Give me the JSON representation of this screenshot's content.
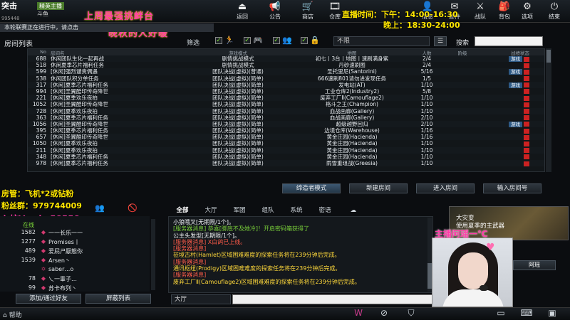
{
  "header": {
    "logo": "突击",
    "channel_badge": "精英主播",
    "channel_name": "斗鱼",
    "channel_code": "995448",
    "buttons": [
      {
        "icon": "back-icon",
        "glyph": "⏏",
        "label": "返回"
      },
      {
        "icon": "announce-icon",
        "glyph": "📢",
        "label": "公告"
      },
      {
        "icon": "shop-icon",
        "glyph": "🛒",
        "label": "商店"
      },
      {
        "icon": "warehouse-icon",
        "glyph": "🎞",
        "label": "仓库"
      },
      {
        "icon": "info-icon",
        "glyph": "👤",
        "label": "信息"
      },
      {
        "icon": "mail-icon",
        "glyph": "✉",
        "label": "邮件"
      },
      {
        "icon": "battle-icon",
        "glyph": "⚔",
        "label": "战队"
      },
      {
        "icon": "backpack-icon",
        "glyph": "🎒",
        "label": "背包"
      },
      {
        "icon": "gear-icon",
        "glyph": "⚙",
        "label": "选项"
      },
      {
        "icon": "power-icon",
        "glyph": "⏻",
        "label": "结束"
      }
    ],
    "stream_time_1": "直播时间：下午：14:00-16:30",
    "stream_time_2": "晚上：18:30-24:00"
  },
  "overlay": {
    "title_1": "上周最强挑衅台",
    "title_2": "晚秋的人好暖",
    "room_admin": "房管：飞机*2或钻粉",
    "fans_group": "粉丝群：979744009",
    "pit_id": "入坑V：sky58558",
    "host_name": "主播阿瑶一℃"
  },
  "status_text": "本轮联赛正在进行中，请点击",
  "room_list": {
    "title": "房间列表",
    "filter_label": "筛选",
    "availability": "不限",
    "search_label": "搜索",
    "search_placeholder": "",
    "columns": [
      "No",
      "房间名",
      "游戏模式",
      "地图",
      "人数",
      "阶级",
      "战绩状态"
    ],
    "rows": [
      {
        "no": "688",
        "name": "休闲团队生化一起再战",
        "mode": "剧情挑战模式",
        "map": "初七丨3台丨地图丨速刷满身紫",
        "count": "2/4",
        "state": "游戏"
      },
      {
        "no": "518",
        "name": "休闲夏季芯片福利任务",
        "mode": "剧情挑战模式",
        "map": "丹砂速刷图",
        "count": "2/4",
        "state": ""
      },
      {
        "no": "599",
        "name": "[休闲]强烈谴责偶遇",
        "mode": "团队决战(虚拟)(普通)",
        "map": "圣托里尼(Santorini)",
        "count": "5/16",
        "state": "游戏"
      },
      {
        "no": "538",
        "name": "休闲团队积分单任务",
        "mode": "团队决战(虚拟)(简单)",
        "map": "666速刷801请勿进发现任务",
        "count": "1/5",
        "state": ""
      },
      {
        "no": "317",
        "name": "[休闲]夏季芯片福利任务",
        "mode": "团队决战(虚拟)(简单)",
        "map": "发电站(AT)",
        "count": "1/10",
        "state": "游戏"
      },
      {
        "no": "994",
        "name": "[休闲]圣翼酷印传奇降世",
        "mode": "团队决战(虚拟)(简单)",
        "map": "工业仓库2(Industry2)",
        "count": "5/8",
        "state": ""
      },
      {
        "no": "221",
        "name": "[休闲]夏季欢乐夜拍",
        "mode": "团队决战(虚拟)(简单)",
        "map": "废弃工厂Ⅱ(Camouflage2)",
        "count": "1/10",
        "state": ""
      },
      {
        "no": "1052",
        "name": "[休闲]圣翼酷印传奇降世",
        "mode": "团队决战(虚拟)(简单)",
        "map": "格斗之王(Champion)",
        "count": "1/10",
        "state": ""
      },
      {
        "no": "728",
        "name": "[休闲]夏季欢乐夜拍",
        "mode": "团队决战(虚拟)(简单)",
        "map": "血战画廊(Gallery)",
        "count": "1/10",
        "state": ""
      },
      {
        "no": "363",
        "name": "[休闲]夏季芯片福利任务",
        "mode": "团队决战(虚拟)(简单)",
        "map": "血战画廊(Gallery)",
        "count": "2/10",
        "state": ""
      },
      {
        "no": "1056",
        "name": "[休闲]圣翼酷印传奇降世",
        "mode": "团队决战(虚拟)(简单)",
        "map": "超级越野回归",
        "count": "2/10",
        "state": "游戏"
      },
      {
        "no": "395",
        "name": "[休闲]夏季芯片福利任务",
        "mode": "团队决战(虚拟)(简单)",
        "map": "边境仓库(Warehouse)",
        "count": "1/16",
        "state": ""
      },
      {
        "no": "657",
        "name": "[休闲]圣翼酷印传奇降世",
        "mode": "团队决战(虚拟)(简单)",
        "map": "黄金庄园(Hacienda)",
        "count": "1/16",
        "state": ""
      },
      {
        "no": "1050",
        "name": "[休闲]夏季欢乐夜拍",
        "mode": "团队决战(虚拟)(简单)",
        "map": "黄金庄园(Hacienda)",
        "count": "1/10",
        "state": ""
      },
      {
        "no": "211",
        "name": "[休闲]夏季欢乐夜拍",
        "mode": "团队决战(虚拟)(简单)",
        "map": "黄金庄园(Hacienda)",
        "count": "1/10",
        "state": ""
      },
      {
        "no": "348",
        "name": "[休闲]夏季芯片福利任务",
        "mode": "团队决战(虚拟)(简单)",
        "map": "黄金庄园(Hacienda)",
        "count": "1/10",
        "state": ""
      },
      {
        "no": "978",
        "name": "[休闲]夏季芯片福利任务",
        "mode": "团队决战(虚拟)(简单)",
        "map": "雨雪重组战(Greesia)",
        "count": "1/10",
        "state": ""
      }
    ]
  },
  "actions": {
    "match": "缔造者模式",
    "new_room": "新建房间",
    "enter_room": "进入房间",
    "enter_number": "输入房间号"
  },
  "friends": {
    "tab_label": "在线",
    "items": [
      {
        "level": "1582",
        "icon": "◆",
        "name": "一一长乐一一"
      },
      {
        "level": "1277",
        "icon": "◆",
        "name": "Promises丨"
      },
      {
        "level": "489",
        "icon": "◆",
        "name": "爱屁ㄕ厭態你"
      },
      {
        "level": "1539",
        "icon": "◆",
        "name": "Arsen丶"
      },
      {
        "level": "",
        "icon": "✡",
        "name": "saber…o"
      },
      {
        "level": "78",
        "icon": "◆",
        "name": "乀一輩子…"
      },
      {
        "level": "99",
        "icon": "◆",
        "name": "苏卡布列丶"
      }
    ],
    "add_button": "添加/通过好友",
    "block_button": "屏蔽列表"
  },
  "chat": {
    "tabs": [
      "全部",
      "大厅",
      "军团",
      "组队",
      "系统",
      "密语",
      "☁"
    ],
    "lines": [
      {
        "color": "white",
        "text": "小狼哦叉[无期限/1个]。"
      },
      {
        "color": "green",
        "text": "[服务器消息] 恭喜[脚底不及她冷]！开启密码箱获得了"
      },
      {
        "color": "white",
        "text": "公主头发型[无期限/1个]。"
      },
      {
        "color": "red",
        "text": "[服务器消息] X白鸽已上线。"
      },
      {
        "color": "red",
        "text": "[服务器消息]"
      },
      {
        "color": "yellow",
        "text": "莅境古村(Hamlet)区域困难难度的探索任务将在239分钟后完成。"
      },
      {
        "color": "red",
        "text": "[服务器消息]"
      },
      {
        "color": "yellow",
        "text": "通讯枢纽(Prodigy)区域困难难度的探索任务将在239分钟后完成。"
      },
      {
        "color": "red",
        "text": "[服务器消息]"
      },
      {
        "color": "yellow",
        "text": "废弃工厂Ⅱ(Camouflage2)区域困难难度的探索任务将在239分钟后完成。"
      }
    ],
    "channel": "大厅",
    "input_value": ""
  },
  "promo": {
    "title": "大灾变",
    "subtitle": "使用夏季的主武器",
    "button": "阿瑶"
  },
  "bottom": {
    "help": "帮助"
  }
}
